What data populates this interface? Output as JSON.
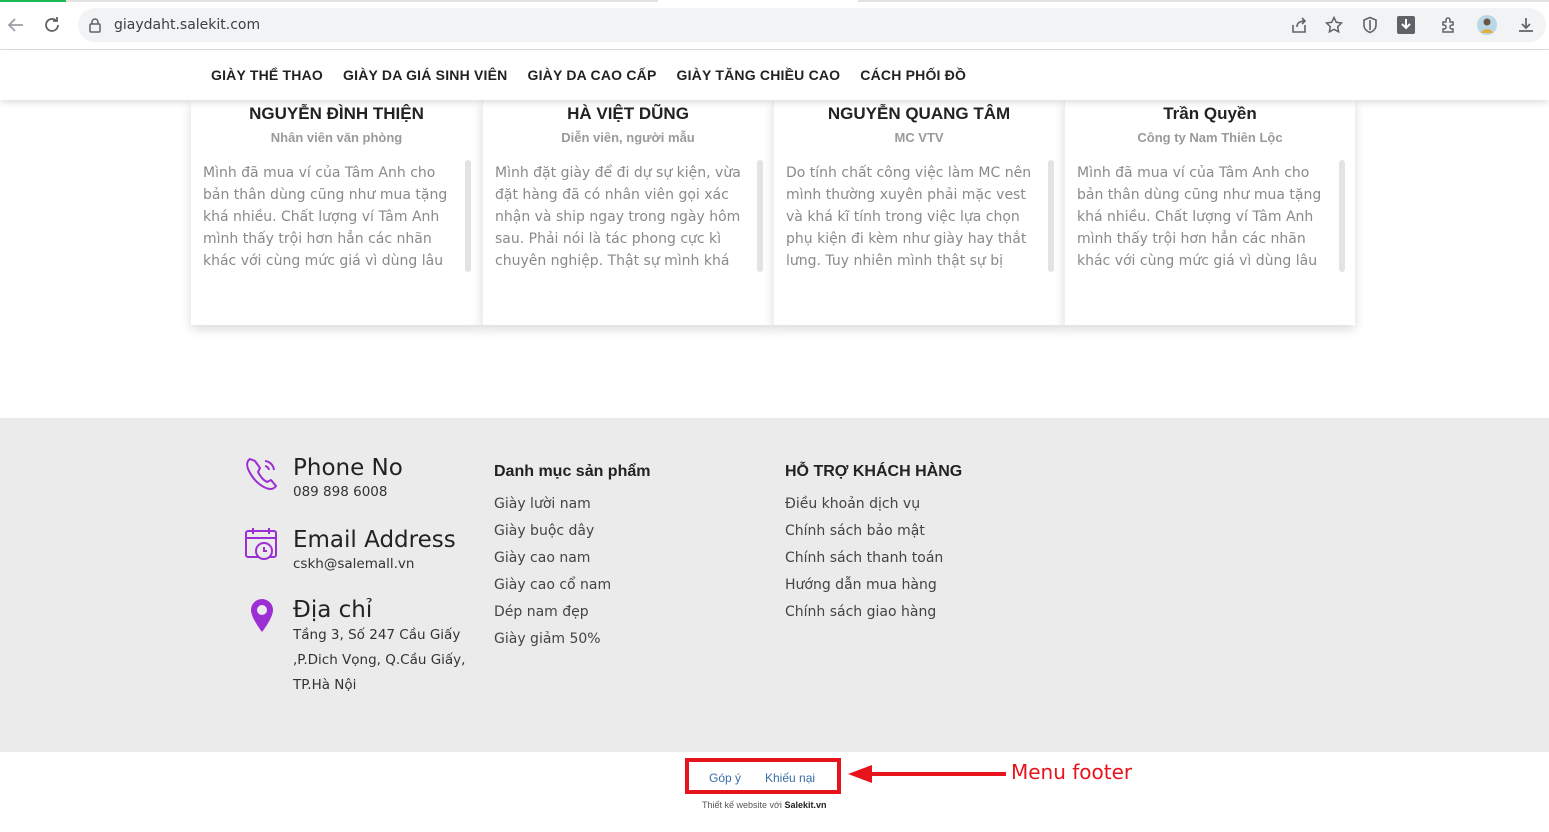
{
  "browser": {
    "url": "giaydaht.salekit.com"
  },
  "nav": {
    "items": [
      "GIÀY THỂ THAO",
      "GIÀY DA GIÁ SINH VIÊN",
      "GIÀY DA CAO CẤP",
      "GIÀY TĂNG CHIỀU CAO",
      "CÁCH PHỐI ĐỒ"
    ]
  },
  "testimonials": [
    {
      "name": "NGUYỄN ĐÌNH THIỆN",
      "role": "Nhân viên văn phòng",
      "quote": "Mình đã mua ví của Tâm Anh cho bản thân dùng cũng như mua tặng khá nhiều. Chất lượng ví Tâm Anh mình thấy trội hơn hẳn các nhãn khác với cùng mức giá vì dùng lâu"
    },
    {
      "name": "HÀ VIỆT DŨNG",
      "role": "Diễn viên, người mẫu",
      "quote": "Mình đặt giày để đi dự sự kiện, vừa đặt hàng đã có nhân viên gọi xác nhận và ship ngay trong ngày hôm sau. Phải nói là tác phong cực kì chuyên nghiệp. Thật sự mình khá"
    },
    {
      "name": "NGUYỄN QUANG TÂM",
      "role": "MC VTV",
      "quote": "Do tính chất công việc làm MC nên mình thường xuyên phải mặc vest và khá kĩ tính trong việc lựa chọn phụ kiện đi kèm như giày hay thắt lưng. Tuy nhiên mình thật sự bị"
    },
    {
      "name": "Trần Quyền",
      "role": "Công ty Nam Thiên Lộc",
      "quote": "Mình đã mua ví của Tâm Anh cho bản thân dùng cũng như mua tặng khá nhiều. Chất lượng ví Tâm Anh mình thấy trội hơn hẳn các nhãn khác với cùng mức giá vì dùng lâu"
    }
  ],
  "footer": {
    "phone_title": "Phone No",
    "phone_value": "089 898 6008",
    "email_title": "Email Address",
    "email_value": "cskh@salemall.vn",
    "address_title": "Địa chỉ",
    "address_lines": [
      "Tầng 3, Số 247 Cầu Giấy",
      ",P.Dich Vọng, Q.Cầu Giấy,",
      "TP.Hà Nội"
    ],
    "products_heading": "Danh mục sản phẩm",
    "products": [
      "Giày lười nam",
      "Giày buộc dây",
      "Giày cao nam",
      "Giày cao cổ nam",
      "Dép nam đẹp",
      "Giày giảm 50%"
    ],
    "support_heading": "HỖ TRỢ KHÁCH HÀNG",
    "support": [
      "Điều khoản dịch vụ",
      "Chính sách bảo mật",
      "Chính sách thanh toán",
      "Hướng dẫn mua hàng",
      "Chính sách giao hàng"
    ]
  },
  "bottom": {
    "menu_items": [
      "Góp ý",
      "Khiếu nại"
    ],
    "credit_prefix": "Thiết kế website với ",
    "credit_brand": "Salekit.vn",
    "annotation": "Menu footer"
  },
  "colors": {
    "accent_purple": "#9b2fd4",
    "highlight_red": "#e8141c",
    "link_blue": "#3a6ea5"
  },
  "icons": [
    "back-arrow-icon",
    "reload-icon",
    "lock-icon",
    "share-icon",
    "star-icon",
    "shield-icon",
    "download-box-icon",
    "extension-icon",
    "profile-avatar",
    "download-icon",
    "phone-icon",
    "calendar-clock-icon",
    "location-pin-icon"
  ]
}
